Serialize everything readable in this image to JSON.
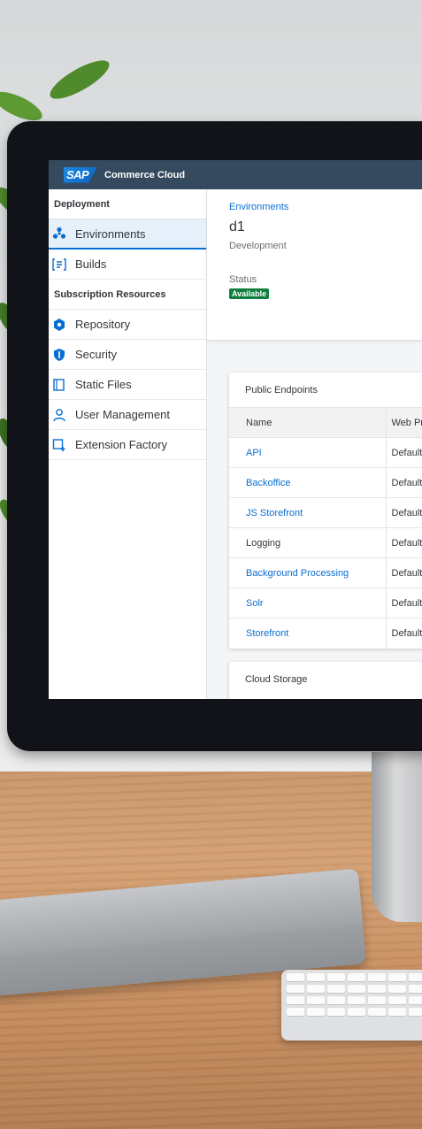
{
  "shell": {
    "logo": "SAP",
    "title": "Commerce Cloud"
  },
  "sidebar": {
    "groups": [
      {
        "title": "Deployment"
      },
      {
        "title": "Subscription Resources"
      }
    ],
    "items": [
      {
        "label": "Environments"
      },
      {
        "label": "Builds"
      },
      {
        "label": "Repository"
      },
      {
        "label": "Security"
      },
      {
        "label": "Static Files"
      },
      {
        "label": "User Management"
      },
      {
        "label": "Extension Factory"
      }
    ]
  },
  "header": {
    "breadcrumb": "Environments",
    "title": "d1",
    "subtitle": "Development",
    "status_label": "Status",
    "status_value": "Available",
    "status_color": "#107e3e"
  },
  "endpoints": {
    "title": "Public Endpoints",
    "columns": [
      "Name",
      "Web Pr"
    ],
    "rows": [
      {
        "name": "API",
        "value": "Default"
      },
      {
        "name": "Backoffice",
        "value": "Default"
      },
      {
        "name": "JS Storefront",
        "value": "Default"
      },
      {
        "name": "Logging",
        "value": "Default"
      },
      {
        "name": "Background Processing",
        "value": "Default"
      },
      {
        "name": "Solr",
        "value": "Default"
      },
      {
        "name": "Storefront",
        "value": "Default"
      }
    ]
  },
  "storage": {
    "title": "Cloud Storage"
  },
  "colors": {
    "shell": "#354a5f",
    "accent": "#0a6ed1",
    "success": "#107e3e"
  },
  "icons": [
    "environments-icon",
    "builds-icon",
    "repository-icon",
    "security-icon",
    "static-files-icon",
    "user-management-icon",
    "extension-factory-icon"
  ]
}
